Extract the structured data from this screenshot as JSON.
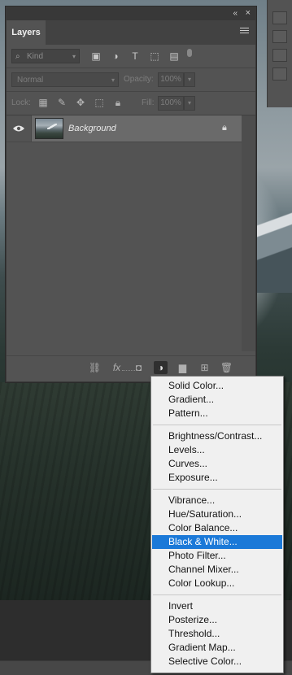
{
  "panel": {
    "tab_title": "Layers",
    "collapse_glyph": "«",
    "close_glyph": "×",
    "filter": {
      "kind_label": "Kind"
    },
    "blend_mode": "Normal",
    "opacity_label": "Opacity:",
    "opacity_value": "100%",
    "lock_label": "Lock:",
    "fill_label": "Fill:",
    "fill_value": "100%",
    "layers": [
      {
        "name": "Background",
        "locked": true,
        "visible": true
      }
    ]
  },
  "menu": {
    "items": [
      "Solid Color...",
      "Gradient...",
      "Pattern...",
      "Brightness/Contrast...",
      "Levels...",
      "Curves...",
      "Exposure...",
      "Vibrance...",
      "Hue/Saturation...",
      "Color Balance...",
      "Black & White...",
      "Photo Filter...",
      "Channel Mixer...",
      "Color Lookup...",
      "Invert",
      "Posterize...",
      "Threshold...",
      "Gradient Map...",
      "Selective Color..."
    ],
    "highlighted": "Black & White..."
  },
  "colors": {
    "menu_highlight": "#1b79d8",
    "panel_bg": "#535353",
    "layer_selected": "#6a6a6a"
  }
}
